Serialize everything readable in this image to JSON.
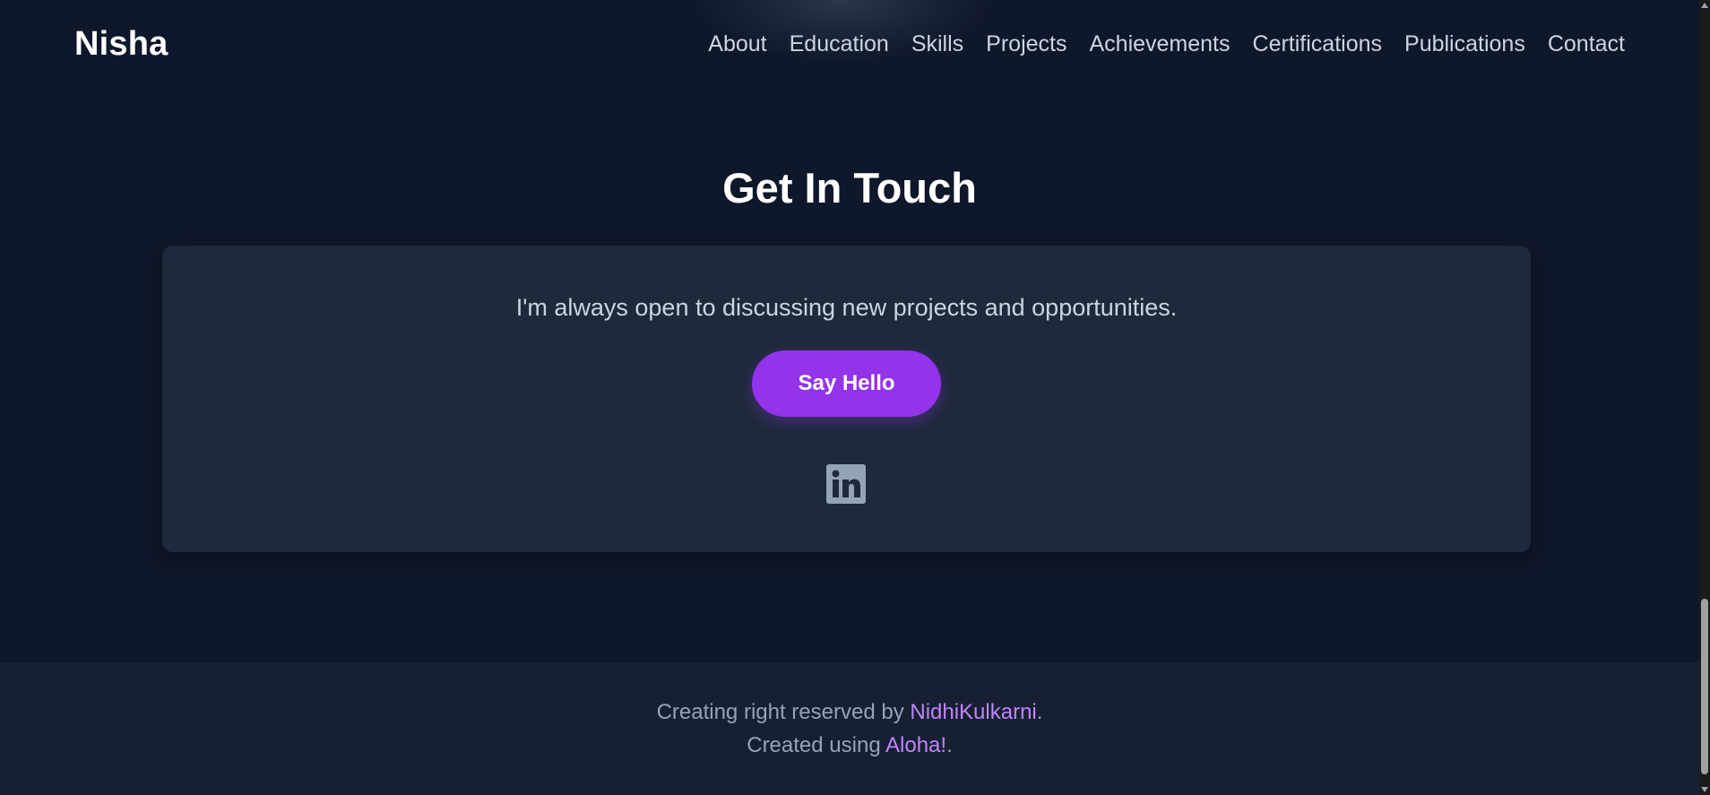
{
  "header": {
    "brand": "Nisha",
    "nav": [
      "About",
      "Education",
      "Skills",
      "Projects",
      "Achievements",
      "Certifications",
      "Publications",
      "Contact"
    ]
  },
  "contact": {
    "title": "Get In Touch",
    "text": "I'm always open to discussing new projects and opportunities.",
    "button_label": "Say Hello",
    "social_icon": "linkedin-icon"
  },
  "footer": {
    "line1_prefix": "Creating right reserved by ",
    "line1_link": "NidhiKulkarni",
    "line1_suffix": ".",
    "line2_prefix": "Created using ",
    "line2_link": "Aloha!",
    "line2_suffix": "."
  },
  "colors": {
    "background": "#0f172a",
    "card": "#1e293b",
    "footer": "#172033",
    "accent": "#9333ea",
    "link": "#c084fc",
    "muted_text": "#94a3b8"
  }
}
